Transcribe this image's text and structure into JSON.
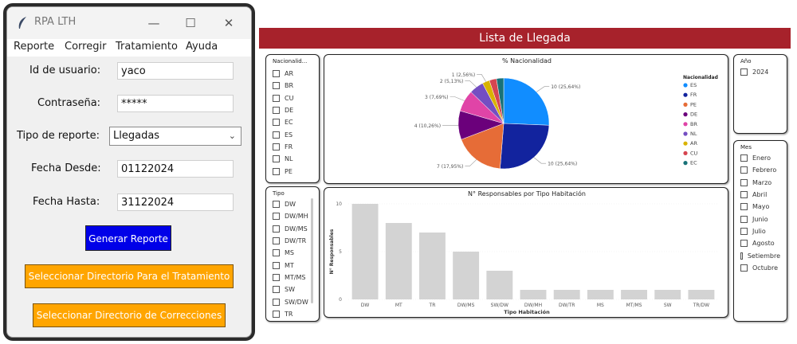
{
  "window": {
    "title": "RPA LTH"
  },
  "menu": [
    "Reporte",
    "Corregir",
    "Tratamiento",
    "Ayuda"
  ],
  "form": {
    "user_label": "Id de usuario:",
    "user_value": "yaco",
    "pass_label": "Contraseña:",
    "pass_value": "*****",
    "type_label": "Tipo de reporte:",
    "type_value": "Llegadas",
    "from_label": "Fecha Desde:",
    "from_value": "01122024",
    "to_label": "Fecha Hasta:",
    "to_value": "31122024",
    "generate_label": "Generar Reporte",
    "treat_dir_label": "Seleccionar Directorio Para el Tratamiento",
    "corr_dir_label": "Seleccionar Directorio de Correcciones"
  },
  "colors": {
    "generate": "#0000e8",
    "orange": "#ffa500",
    "banner": "#a7222b"
  },
  "dashboard": {
    "title": "Lista de Llegada",
    "nat_slicer": {
      "header": "Nacionalid...",
      "items": [
        "AR",
        "BR",
        "CU",
        "DE",
        "EC",
        "ES",
        "FR",
        "NL",
        "PE"
      ]
    },
    "tipo_slicer": {
      "header": "Tipo",
      "items": [
        "DW",
        "DW/MH",
        "DW/MS",
        "DW/TR",
        "MS",
        "MT",
        "MT/MS",
        "SW",
        "SW/DW",
        "TR"
      ]
    },
    "year_slicer": {
      "header": "Año",
      "items": [
        "2024"
      ]
    },
    "month_slicer": {
      "header": "Mes",
      "items": [
        "Enero",
        "Febrero",
        "Marzo",
        "Abril",
        "Mayo",
        "Junio",
        "Julio",
        "Agosto",
        "Setiembre",
        "Octubre"
      ]
    }
  },
  "chart_data": [
    {
      "type": "pie",
      "title": "% Nacionalidad",
      "legend_title": "Nacionalidad",
      "legend_position": "right",
      "slices": [
        {
          "name": "ES",
          "value": 10,
          "label": "10 (25,64%)",
          "color": "#118dff"
        },
        {
          "name": "FR",
          "value": 10,
          "label": "10 (25,64%)",
          "color": "#12239e"
        },
        {
          "name": "PE",
          "value": 7,
          "label": "7 (17,95%)",
          "color": "#e66c37"
        },
        {
          "name": "DE",
          "value": 4,
          "label": "4 (10,26%)",
          "color": "#6b007b"
        },
        {
          "name": "BR",
          "value": 3,
          "label": "3 (7,69%)",
          "color": "#e044a7"
        },
        {
          "name": "NL",
          "value": 2,
          "label": "2 (5,13%)",
          "color": "#744ec2"
        },
        {
          "name": "AR",
          "value": 1,
          "label": "1 (2,56%)",
          "color": "#d9b300"
        },
        {
          "name": "CU",
          "value": 1,
          "label": "",
          "color": "#d64550"
        },
        {
          "name": "EC",
          "value": 1,
          "label": "",
          "color": "#197278"
        }
      ]
    },
    {
      "type": "bar",
      "title": "N° Responsables por Tipo Habitación",
      "xlabel": "Tipo Habitación",
      "ylabel": "N° Responsables",
      "categories": [
        "DW",
        "MT",
        "TR",
        "DW/MS",
        "SW/DW",
        "DW/MH",
        "DW/TR",
        "MS",
        "MT/MS",
        "SW",
        "TR/DW"
      ],
      "values": [
        10,
        8,
        7,
        5,
        3,
        1,
        1,
        1,
        1,
        1,
        1
      ],
      "ylim": [
        0,
        10
      ],
      "yticks": [
        0,
        5,
        10
      ],
      "bar_color": "#d3d3d3"
    }
  ]
}
